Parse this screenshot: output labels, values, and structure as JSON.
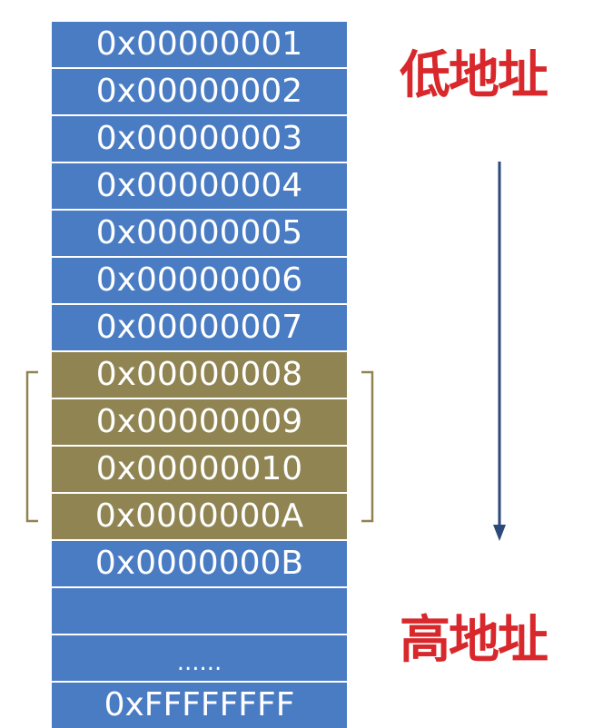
{
  "memory": {
    "cells": [
      {
        "text": "0x00000001",
        "kind": "blue"
      },
      {
        "text": "0x00000002",
        "kind": "blue"
      },
      {
        "text": "0x00000003",
        "kind": "blue"
      },
      {
        "text": "0x00000004",
        "kind": "blue"
      },
      {
        "text": "0x00000005",
        "kind": "blue"
      },
      {
        "text": "0x00000006",
        "kind": "blue"
      },
      {
        "text": "0x00000007",
        "kind": "blue"
      },
      {
        "text": "0x00000008",
        "kind": "gold"
      },
      {
        "text": "0x00000009",
        "kind": "gold"
      },
      {
        "text": "0x00000010",
        "kind": "gold"
      },
      {
        "text": "0x0000000A",
        "kind": "gold"
      },
      {
        "text": "0x0000000B",
        "kind": "blue"
      },
      {
        "text": "",
        "kind": "blue"
      },
      {
        "text": "......",
        "kind": "blue"
      },
      {
        "text": "0xFFFFFFFF",
        "kind": "blue"
      }
    ]
  },
  "labels": {
    "low_address": "低地址",
    "high_address": "高地址"
  },
  "colors": {
    "cell_blue": "#4a7cc4",
    "cell_gold": "#8f8452",
    "label_red": "#d8282c",
    "arrow": "#2b4a7a",
    "bracket": "#8f8452"
  },
  "icons": {
    "direction_arrow": "arrow-down-icon",
    "group_bracket": "bracket-icon"
  }
}
